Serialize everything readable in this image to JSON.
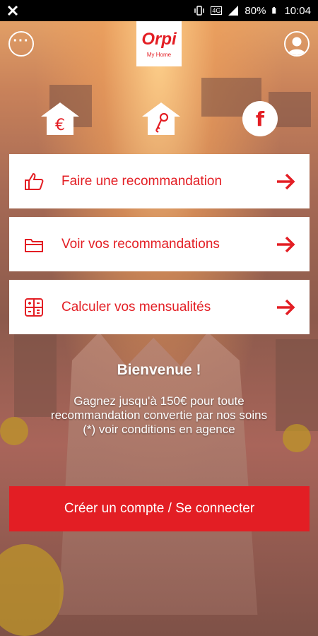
{
  "status_bar": {
    "battery": "80%",
    "time": "10:04",
    "network_badge": "4G"
  },
  "header": {
    "logo_brand": "Orpi",
    "logo_sub": "My Home"
  },
  "shortcuts": {
    "euro_symbol": "€",
    "facebook_letter": "f"
  },
  "actions": [
    {
      "label": "Faire une recommandation",
      "icon": "thumbs-up-icon"
    },
    {
      "label": "Voir vos recommandations",
      "icon": "folder-icon"
    },
    {
      "label": "Calculer vos mensualités",
      "icon": "calculator-icon"
    }
  ],
  "welcome": {
    "title": "Bienvenue !",
    "line1": "Gagnez jusqu'à 150€ pour toute recommandation convertie par nos soins",
    "line2": "(*) voir conditions en agence"
  },
  "cta": {
    "label": "Créer un compte / Se connecter"
  },
  "colors": {
    "brand_red": "#e31e24",
    "white": "#ffffff"
  }
}
